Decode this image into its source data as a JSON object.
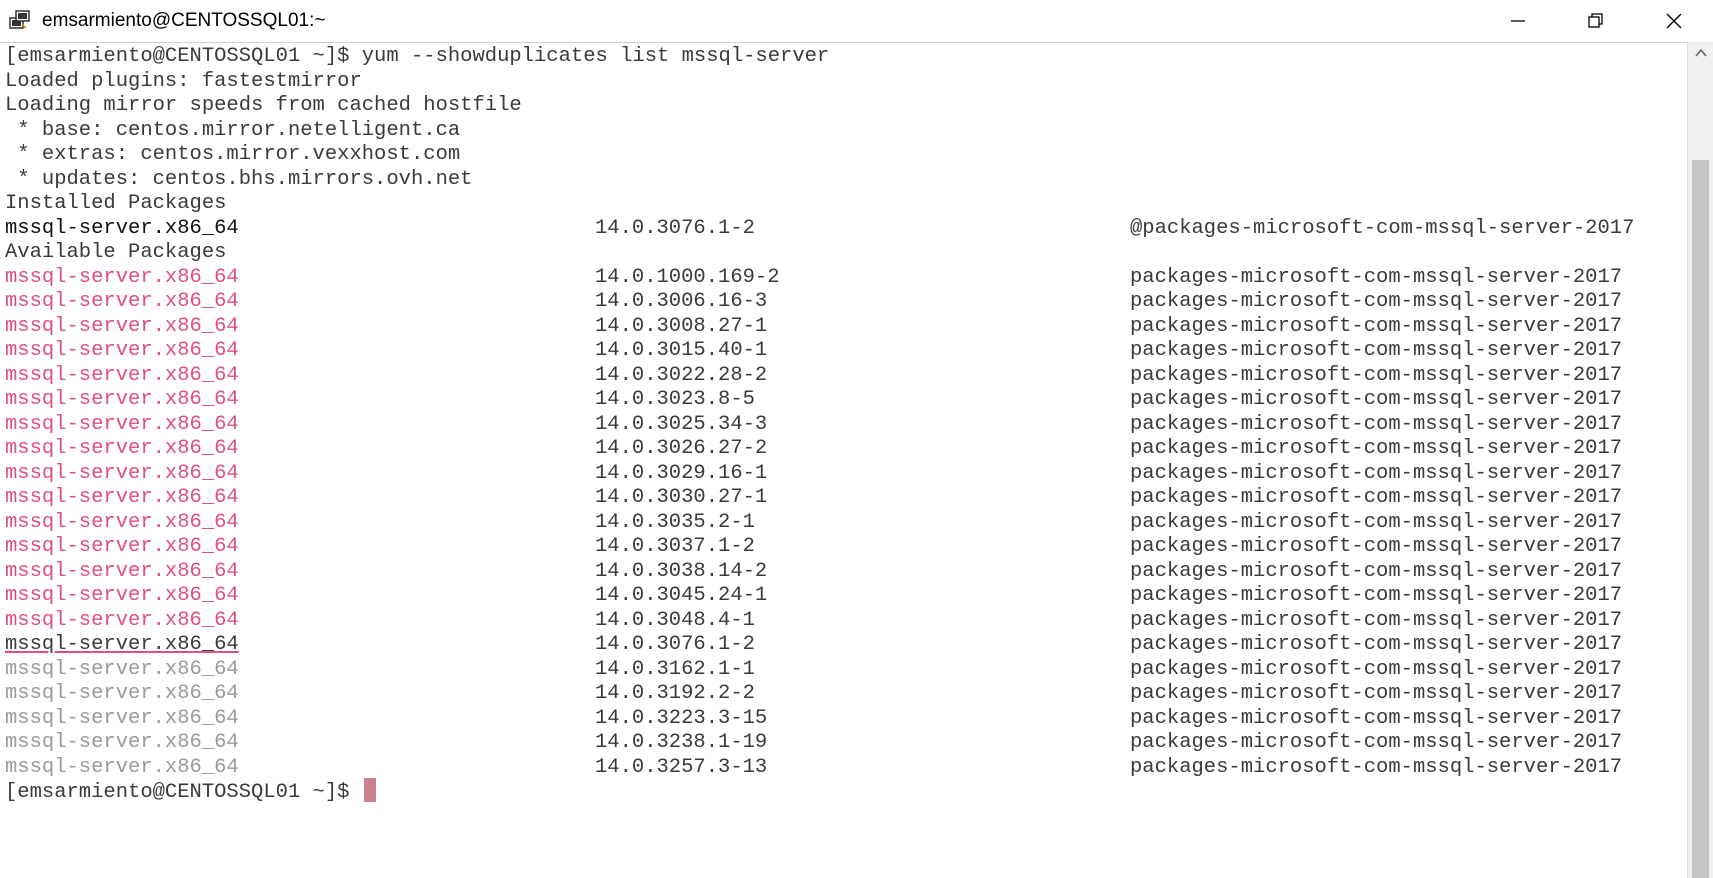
{
  "window": {
    "title": "emsarmiento@CENTOSSQL01:~",
    "app_icon": "putty-icon",
    "controls": [
      "minimize-icon",
      "maximize-icon",
      "close-icon"
    ]
  },
  "terminal": {
    "header_lines": [
      "[emsarmiento@CENTOSSQL01 ~]$ yum --showduplicates list mssql-server",
      "Loaded plugins: fastestmirror",
      "Loading mirror speeds from cached hostfile",
      " * base: centos.mirror.netelligent.ca",
      " * extras: centos.mirror.vexxhost.com",
      " * updates: centos.bhs.mirrors.ovh.net",
      "Installed Packages"
    ],
    "installed": [
      {
        "name": "mssql-server.x86_64",
        "version": "14.0.3076.1-2",
        "repo": "@packages-microsoft-com-mssql-server-2017"
      }
    ],
    "available_header": "Available Packages",
    "available": [
      {
        "name": "mssql-server.x86_64",
        "version": "14.0.1000.169-2",
        "repo": "packages-microsoft-com-mssql-server-2017",
        "style": "red"
      },
      {
        "name": "mssql-server.x86_64",
        "version": "14.0.3006.16-3",
        "repo": "packages-microsoft-com-mssql-server-2017",
        "style": "red"
      },
      {
        "name": "mssql-server.x86_64",
        "version": "14.0.3008.27-1",
        "repo": "packages-microsoft-com-mssql-server-2017",
        "style": "red"
      },
      {
        "name": "mssql-server.x86_64",
        "version": "14.0.3015.40-1",
        "repo": "packages-microsoft-com-mssql-server-2017",
        "style": "red"
      },
      {
        "name": "mssql-server.x86_64",
        "version": "14.0.3022.28-2",
        "repo": "packages-microsoft-com-mssql-server-2017",
        "style": "red"
      },
      {
        "name": "mssql-server.x86_64",
        "version": "14.0.3023.8-5",
        "repo": "packages-microsoft-com-mssql-server-2017",
        "style": "red"
      },
      {
        "name": "mssql-server.x86_64",
        "version": "14.0.3025.34-3",
        "repo": "packages-microsoft-com-mssql-server-2017",
        "style": "red"
      },
      {
        "name": "mssql-server.x86_64",
        "version": "14.0.3026.27-2",
        "repo": "packages-microsoft-com-mssql-server-2017",
        "style": "red"
      },
      {
        "name": "mssql-server.x86_64",
        "version": "14.0.3029.16-1",
        "repo": "packages-microsoft-com-mssql-server-2017",
        "style": "red"
      },
      {
        "name": "mssql-server.x86_64",
        "version": "14.0.3030.27-1",
        "repo": "packages-microsoft-com-mssql-server-2017",
        "style": "red"
      },
      {
        "name": "mssql-server.x86_64",
        "version": "14.0.3035.2-1",
        "repo": "packages-microsoft-com-mssql-server-2017",
        "style": "red"
      },
      {
        "name": "mssql-server.x86_64",
        "version": "14.0.3037.1-2",
        "repo": "packages-microsoft-com-mssql-server-2017",
        "style": "red"
      },
      {
        "name": "mssql-server.x86_64",
        "version": "14.0.3038.14-2",
        "repo": "packages-microsoft-com-mssql-server-2017",
        "style": "red"
      },
      {
        "name": "mssql-server.x86_64",
        "version": "14.0.3045.24-1",
        "repo": "packages-microsoft-com-mssql-server-2017",
        "style": "red"
      },
      {
        "name": "mssql-server.x86_64",
        "version": "14.0.3048.4-1",
        "repo": "packages-microsoft-com-mssql-server-2017",
        "style": "red"
      },
      {
        "name": "mssql-server.x86_64",
        "version": "14.0.3076.1-2",
        "repo": "packages-microsoft-com-mssql-server-2017",
        "style": "underline"
      },
      {
        "name": "mssql-server.x86_64",
        "version": "14.0.3162.1-1",
        "repo": "packages-microsoft-com-mssql-server-2017",
        "style": "gray"
      },
      {
        "name": "mssql-server.x86_64",
        "version": "14.0.3192.2-2",
        "repo": "packages-microsoft-com-mssql-server-2017",
        "style": "gray"
      },
      {
        "name": "mssql-server.x86_64",
        "version": "14.0.3223.3-15",
        "repo": "packages-microsoft-com-mssql-server-2017",
        "style": "gray"
      },
      {
        "name": "mssql-server.x86_64",
        "version": "14.0.3238.1-19",
        "repo": "packages-microsoft-com-mssql-server-2017",
        "style": "gray"
      },
      {
        "name": "mssql-server.x86_64",
        "version": "14.0.3257.3-13",
        "repo": "packages-microsoft-com-mssql-server-2017",
        "style": "gray"
      }
    ],
    "prompt": "[emsarmiento@CENTOSSQL01 ~]$ "
  },
  "colors": {
    "text": "#3a3a3a",
    "bold": "#111111",
    "red": "#e0507a",
    "gray": "#9a9a9a",
    "cursor": "#c9828e"
  }
}
